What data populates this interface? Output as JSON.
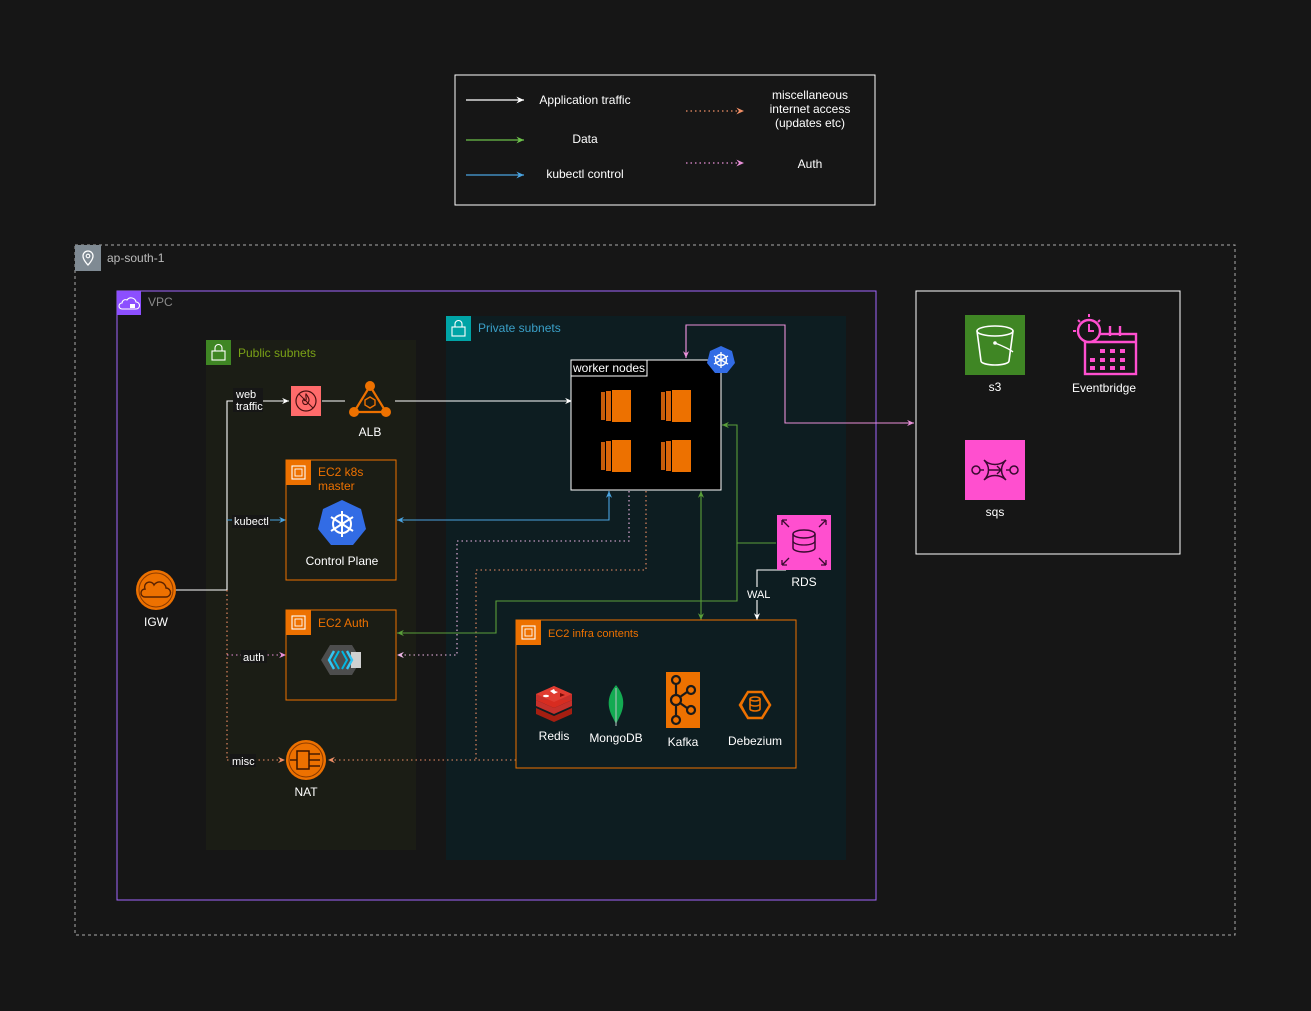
{
  "legend": {
    "items": [
      {
        "label": "Application traffic",
        "color": "#ffffff",
        "style": "solid"
      },
      {
        "label": "Data",
        "color": "#6cc04a",
        "style": "solid"
      },
      {
        "label": "kubectl control",
        "color": "#4aa3e0",
        "style": "solid"
      },
      {
        "label": "miscellaneous\ninternet access\n(updates etc)",
        "color": "#f08f66",
        "style": "dotted"
      },
      {
        "label": "Auth",
        "color": "#e88fd8",
        "style": "dotted"
      }
    ]
  },
  "groups": {
    "region": "ap-south-1",
    "vpc": "VPC",
    "public_subnets": "Public subnets",
    "private_subnets": "Private subnets",
    "worker_nodes": "worker nodes",
    "ec2_master": "EC2 k8s\nmaster",
    "ec2_auth": "EC2 Auth",
    "ec2_infra": "EC2 infra contents"
  },
  "nodes": {
    "igw": "IGW",
    "alb": "ALB",
    "control_plane": "Control Plane",
    "nat": "NAT",
    "rds": "RDS",
    "redis": "Redis",
    "mongodb": "MongoDB",
    "kafka": "Kafka",
    "debezium": "Debezium",
    "s3": "s3",
    "eventbridge": "Eventbridge",
    "sqs": "sqs"
  },
  "edge_labels": {
    "web_traffic": "web\ntraffic",
    "kubectl": "kubectl",
    "auth": "auth",
    "misc": "misc",
    "wal": "WAL"
  },
  "colors": {
    "background": "#161616",
    "white": "#ffffff",
    "data": "#6cc04a",
    "kubectl": "#4aa3e0",
    "misc": "#f08f66",
    "auth": "#e88fd8",
    "vpc": "#a166ff",
    "public": "#7aa116",
    "private": "#147eba",
    "aws_orange": "#ed7100",
    "aws_pink": "#ff4f8b",
    "k8s_blue": "#326ce5"
  },
  "icons": {
    "region": "location-pin-icon",
    "vpc": "cloud-lock-icon",
    "public": "padlock-icon",
    "private": "padlock-icon",
    "waf": "firewall-icon",
    "alb": "load-balancer-icon",
    "kubernetes": "kubernetes-wheel-icon",
    "ec2": "chip-icon",
    "ec2_instance": "ec2-instance-icon",
    "igw": "cloud-gateway-icon",
    "nat": "nat-gateway-icon",
    "keycloak": "keycloak-icon",
    "rds": "database-icon",
    "redis": "redis-icon",
    "mongodb": "leaf-icon",
    "kafka": "kafka-icon",
    "debezium": "debezium-icon",
    "s3": "bucket-icon",
    "eventbridge": "calendar-clock-icon",
    "sqs": "queue-icon"
  }
}
